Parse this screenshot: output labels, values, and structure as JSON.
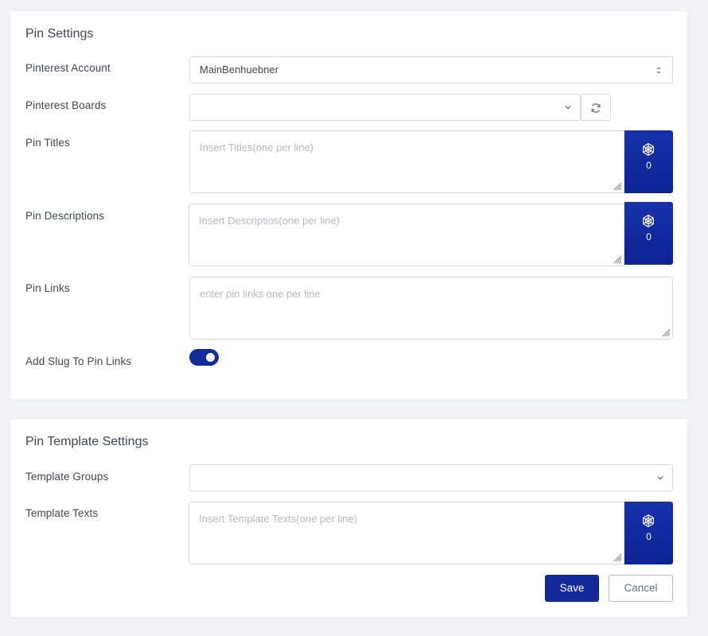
{
  "pin_settings": {
    "title": "Pin Settings",
    "account": {
      "label": "Pinterest Account",
      "value": "MainBenhuebner"
    },
    "boards": {
      "label": "Pinterest Boards",
      "value": ""
    },
    "titles": {
      "label": "Pin Titles",
      "placeholder": "Insert Titles(one per line)",
      "ai_count": "0"
    },
    "descriptions": {
      "label": "Pin Descriptions",
      "placeholder": "Insert Descriptios(one per line)",
      "ai_count": "0"
    },
    "links": {
      "label": "Pin Links",
      "placeholder": "enter pin links one per line"
    },
    "slug": {
      "label": "Add Slug To Pin Links",
      "enabled": true
    }
  },
  "template_settings": {
    "title": "Pin Template Settings",
    "groups": {
      "label": "Template Groups",
      "value": ""
    },
    "texts": {
      "label": "Template Texts",
      "placeholder": "Insert Template Texts(one per line)",
      "ai_count": "0"
    }
  },
  "actions": {
    "save_label": "Save",
    "cancel_label": "Cancel"
  },
  "icons": {
    "ai": "openai-icon",
    "refresh": "refresh-icon",
    "dropdown": "chevron-down-icon",
    "sort": "updown-arrows-icon",
    "resize": "resize-grip-icon"
  },
  "colors": {
    "accent": "#14299a",
    "border": "#d9dce3",
    "background": "#f1f2f6"
  }
}
